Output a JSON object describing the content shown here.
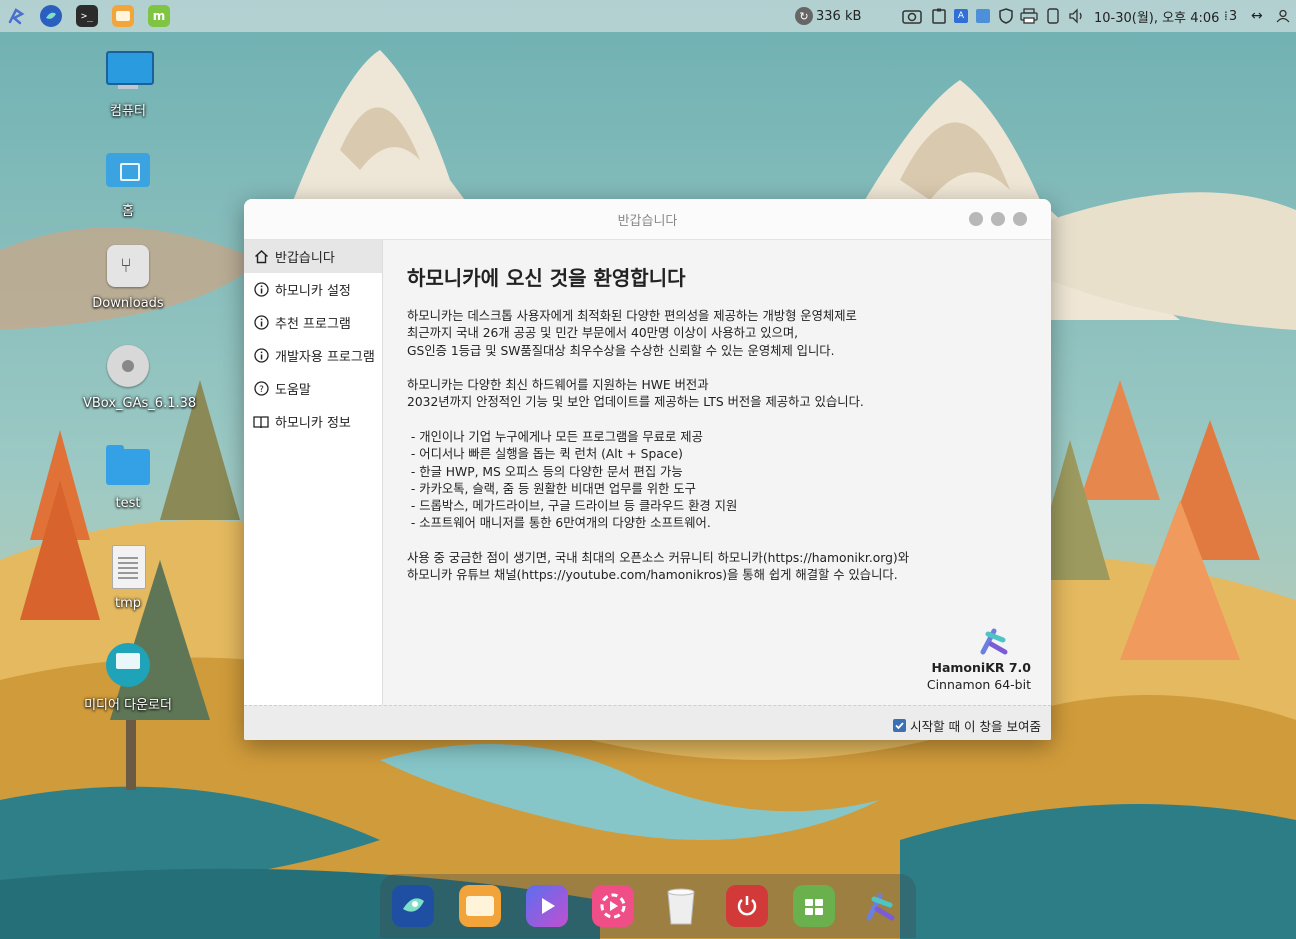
{
  "top_panel": {
    "network_speed": "336 kB",
    "clock": "10-30(월), 오후 4:06",
    "workspace_count": "3"
  },
  "desktop_icons": [
    {
      "label": "컴퓨터"
    },
    {
      "label": "홈"
    },
    {
      "label": "Downloads"
    },
    {
      "label": "VBox_GAs_6.1.38"
    },
    {
      "label": "test"
    },
    {
      "label": "tmp"
    },
    {
      "label": "미디어 다운로더"
    }
  ],
  "dialog": {
    "title": "반갑습니다",
    "sidebar": [
      {
        "label": "반갑습니다",
        "icon": "home-icon"
      },
      {
        "label": "하모니카 설정",
        "icon": "info-icon"
      },
      {
        "label": "추천 프로그램",
        "icon": "info-icon"
      },
      {
        "label": "개발자용 프로그램",
        "icon": "info-icon"
      },
      {
        "label": "도움말",
        "icon": "help-icon"
      },
      {
        "label": "하모니카 정보",
        "icon": "book-icon"
      }
    ],
    "heading": "하모니카에 오신 것을 환영합니다",
    "paragraphs": [
      "하모니카는 데스크톱 사용자에게 최적화된 다양한 편의성을 제공하는 개방형 운영체제로",
      "최근까지 국내 26개 공공 및 민간 부문에서 40만명 이상이 사용하고 있으며,",
      "GS인증 1등급 및 SW품질대상 최우수상을 수상한 신뢰할 수 있는 운영체제 입니다.",
      "하모니카는 다양한 최신 하드웨어를 지원하는 HWE 버전과",
      "2032년까지 안정적인 기능 및 보안 업데이트를 제공하는 LTS 버전을 제공하고 있습니다.",
      " - 개인이나 기업 누구에게나 모든 프로그램을 무료로 제공",
      " - 어디서나 빠른 실행을 돕는 퀵 런처 (Alt + Space)",
      " - 한글 HWP, MS 오피스 등의 다양한 문서 편집 가능",
      " - 카카오톡, 슬랙, 줌 등 원활한 비대면 업무를 위한 도구",
      " - 드롭박스, 메가드라이브, 구글 드라이브 등 클라우드 환경 지원",
      " - 소프트웨어 매니저를 통한 6만여개의 다양한 소프트웨어.",
      "사용 중 궁금한 점이 생기면, 국내 최대의 오픈소스 커뮤니티 하모니카(https://hamonikr.org)와",
      "하모니카 유튜브 채널(https://youtube.com/hamonikros)을 통해 쉽게 해결할 수 있습니다."
    ],
    "brand_name": "HamoniKR 7.0",
    "brand_edition": "Cinnamon 64-bit",
    "show_on_startup_label": "시작할 때 이 창을 보여줌",
    "show_on_startup_checked": true
  },
  "dock": [
    {
      "name": "hamonikr-browser"
    },
    {
      "name": "files"
    },
    {
      "name": "media-player"
    },
    {
      "name": "video-app"
    },
    {
      "name": "trash"
    },
    {
      "name": "power"
    },
    {
      "name": "software-manager"
    },
    {
      "name": "hamonikr-launcher"
    }
  ]
}
